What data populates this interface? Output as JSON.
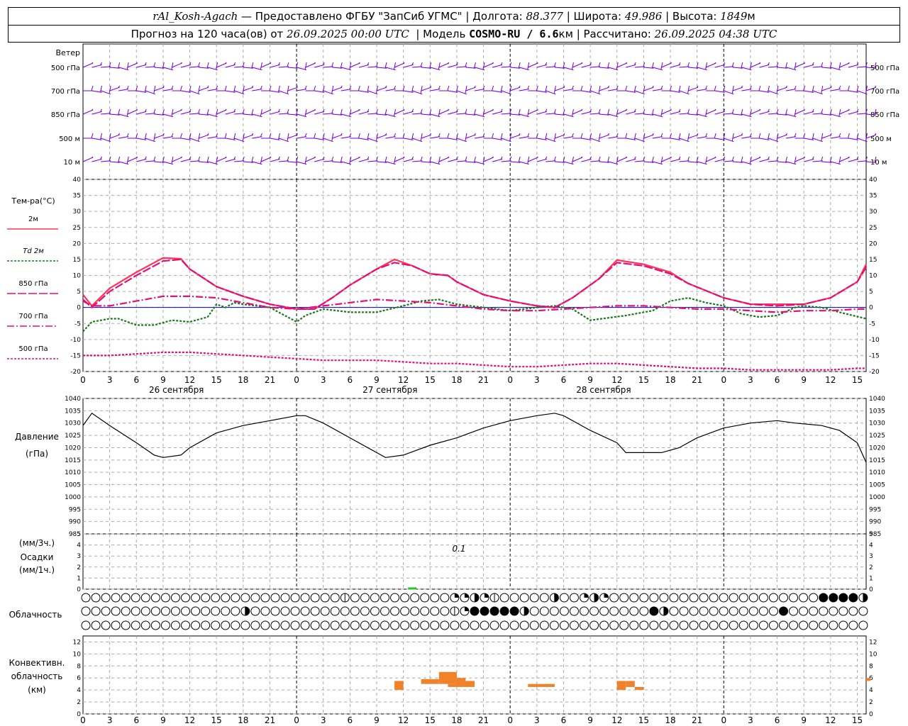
{
  "header": {
    "station": "rAl_Kosh-Agach",
    "provider": " — Предоставлено ФГБУ \"ЗапСиб УГМС\" | Долгота: ",
    "lon": "88.377",
    "lat_label": " | Широта: ",
    "lat": "49.986",
    "alt_label": " | Высота: ",
    "alt": "1849",
    "alt_unit": "м",
    "forecast_label": "Прогноз на 120 часа(ов) от ",
    "run": "26.09.2025 00:00 UTC",
    "model_label": "  | Модель ",
    "model": "COSMO-RU / 6.6",
    "model_unit": "км",
    "calc_label": " | Рассчитано: ",
    "calc": "26.09.2025 04:38 UTC"
  },
  "labels": {
    "wind": "Ветер",
    "wind_levels": [
      "500 гПа",
      "700 гПа",
      "850 гПа",
      "500 м",
      "10 м"
    ],
    "temp": "Тем-ра(°С)",
    "legend": [
      {
        "text": "2м",
        "color": "#ff3355",
        "dash": ""
      },
      {
        "text": "Td 2м",
        "color": "#1a7a1a",
        "dash": "3,2"
      },
      {
        "text": "850 гПа",
        "color": "#e0107a",
        "dash": "12,3"
      },
      {
        "text": "700 гПа",
        "color": "#e0107a",
        "dash": "10,3,2,3"
      },
      {
        "text": "500 гПа",
        "color": "#e0107a",
        "dash": "3,2"
      }
    ],
    "pressure": [
      "Давление",
      "(гПа)"
    ],
    "precip": [
      "(мм/3ч.)",
      "Осадки",
      "(мм/1ч.)"
    ],
    "precip_value": "0.1",
    "cloud": "Облачность",
    "conv": [
      "Конвективн.",
      "облачность",
      "(км)"
    ],
    "dates": [
      "26 сентября",
      "27 сентября",
      "28 сентября"
    ]
  },
  "chart_data": {
    "type": "line",
    "x_hours_from_start": [
      0,
      6,
      12,
      18,
      24,
      30,
      36,
      42,
      48,
      54,
      60,
      66,
      72,
      78
    ],
    "x_tick_labels": [
      "0",
      "3",
      "6",
      "9",
      "12",
      "15",
      "18",
      "21"
    ],
    "temp_axis": {
      "ylim": [
        -20,
        40
      ],
      "ticks": [
        -20,
        -15,
        -10,
        -5,
        0,
        5,
        10,
        15,
        20,
        25,
        30,
        35,
        40
      ]
    },
    "pressure_axis": {
      "ylim": [
        985,
        1040
      ],
      "ticks": [
        985,
        990,
        995,
        1000,
        1005,
        1010,
        1015,
        1020,
        1025,
        1030,
        1035,
        1040
      ]
    },
    "precip_axis": {
      "ylim": [
        0,
        5
      ],
      "ticks": [
        0,
        1,
        2,
        3,
        4,
        5
      ]
    },
    "conv_axis": {
      "ylim": [
        0,
        13
      ],
      "ticks": [
        0,
        2,
        4,
        6,
        8,
        10,
        12
      ]
    },
    "series": [
      {
        "name": "2м",
        "color": "#ff3355",
        "dash": "",
        "points": [
          [
            0,
            4
          ],
          [
            1,
            0.5
          ],
          [
            3,
            6
          ],
          [
            6,
            11
          ],
          [
            9,
            15.5
          ],
          [
            11,
            15.2
          ],
          [
            12,
            12
          ],
          [
            15,
            6.5
          ],
          [
            18,
            3.5
          ],
          [
            21,
            1
          ],
          [
            24,
            -0.5
          ],
          [
            26,
            -0.5
          ],
          [
            28,
            3
          ],
          [
            30,
            7
          ],
          [
            33,
            12
          ],
          [
            35,
            15
          ],
          [
            37,
            13
          ],
          [
            39,
            10.5
          ],
          [
            41,
            10
          ],
          [
            42,
            8
          ],
          [
            45,
            4
          ],
          [
            48,
            2
          ],
          [
            51,
            0.5
          ],
          [
            53,
            0
          ],
          [
            55,
            3
          ],
          [
            58,
            9
          ],
          [
            60,
            14.8
          ],
          [
            63,
            13.5
          ],
          [
            66,
            11
          ],
          [
            68,
            7.5
          ],
          [
            72,
            3
          ],
          [
            75,
            1
          ],
          [
            78,
            1
          ],
          [
            81,
            1
          ],
          [
            84,
            3
          ],
          [
            87,
            8
          ],
          [
            88,
            13.5
          ]
        ]
      },
      {
        "name": "Td 2м",
        "color": "#1a7a1a",
        "dash": "3,2",
        "points": [
          [
            0,
            -7.5
          ],
          [
            1,
            -4.5
          ],
          [
            3,
            -3.5
          ],
          [
            4,
            -3.5
          ],
          [
            6,
            -5.5
          ],
          [
            8,
            -5.5
          ],
          [
            10,
            -4
          ],
          [
            12,
            -4.5
          ],
          [
            14,
            -3
          ],
          [
            15,
            1
          ],
          [
            16,
            0
          ],
          [
            17,
            1.5
          ],
          [
            18,
            1
          ],
          [
            21,
            0
          ],
          [
            24,
            -4.5
          ],
          [
            25,
            -2.5
          ],
          [
            27,
            -0.5
          ],
          [
            30,
            -1.5
          ],
          [
            33,
            -1.5
          ],
          [
            36,
            0.5
          ],
          [
            38,
            2
          ],
          [
            40,
            2.5
          ],
          [
            42,
            1
          ],
          [
            45,
            0
          ],
          [
            48,
            -1
          ],
          [
            51,
            0
          ],
          [
            53,
            0.5
          ],
          [
            55,
            -0.5
          ],
          [
            57,
            -4
          ],
          [
            61,
            -2.5
          ],
          [
            64,
            -1
          ],
          [
            66,
            2
          ],
          [
            68,
            3
          ],
          [
            70,
            1.5
          ],
          [
            72,
            0.5
          ],
          [
            74,
            -2
          ],
          [
            76,
            -3
          ],
          [
            78,
            -2.5
          ],
          [
            80,
            0
          ],
          [
            81,
            0.5
          ],
          [
            83,
            0
          ],
          [
            85,
            -1.5
          ],
          [
            88,
            -3.5
          ]
        ]
      },
      {
        "name": "850 гПа",
        "color": "#e0107a",
        "dash": "12,3",
        "points": [
          [
            0,
            2.5
          ],
          [
            1,
            0
          ],
          [
            3,
            5
          ],
          [
            6,
            10
          ],
          [
            9,
            14.5
          ],
          [
            11,
            15
          ],
          [
            12,
            12
          ],
          [
            15,
            6.5
          ],
          [
            18,
            3.5
          ],
          [
            21,
            1
          ],
          [
            24,
            -0.5
          ],
          [
            26,
            -0.5
          ],
          [
            28,
            3
          ],
          [
            30,
            7
          ],
          [
            33,
            12
          ],
          [
            35,
            14
          ],
          [
            37,
            13
          ],
          [
            39,
            10.5
          ],
          [
            41,
            10
          ],
          [
            42,
            8
          ],
          [
            45,
            4
          ],
          [
            48,
            2
          ],
          [
            51,
            0.5
          ],
          [
            53,
            0
          ],
          [
            55,
            3
          ],
          [
            58,
            9
          ],
          [
            60,
            14
          ],
          [
            63,
            13
          ],
          [
            66,
            10.5
          ],
          [
            68,
            7.5
          ],
          [
            72,
            3
          ],
          [
            75,
            1
          ],
          [
            78,
            0.5
          ],
          [
            81,
            1
          ],
          [
            84,
            3
          ],
          [
            87,
            8
          ],
          [
            88,
            12.5
          ]
        ]
      },
      {
        "name": "700 гПа",
        "color": "#e0107a",
        "dash": "10,3,2,3",
        "points": [
          [
            0,
            2
          ],
          [
            1,
            0.5
          ],
          [
            3,
            0.5
          ],
          [
            6,
            2
          ],
          [
            9,
            3.5
          ],
          [
            12,
            3.5
          ],
          [
            15,
            3
          ],
          [
            18,
            1.5
          ],
          [
            21,
            0
          ],
          [
            24,
            -0.5
          ],
          [
            27,
            0.5
          ],
          [
            30,
            1.5
          ],
          [
            33,
            2.5
          ],
          [
            36,
            2
          ],
          [
            39,
            1.5
          ],
          [
            42,
            0.5
          ],
          [
            45,
            -0.5
          ],
          [
            48,
            -1
          ],
          [
            51,
            -1
          ],
          [
            54,
            -0.5
          ],
          [
            57,
            0
          ],
          [
            60,
            0.5
          ],
          [
            63,
            0.5
          ],
          [
            66,
            0
          ],
          [
            69,
            -0.5
          ],
          [
            72,
            -0.5
          ],
          [
            75,
            -1
          ],
          [
            78,
            -1.5
          ],
          [
            81,
            -1
          ],
          [
            84,
            -1
          ],
          [
            87,
            -0.5
          ],
          [
            88,
            -0.5
          ]
        ]
      },
      {
        "name": "500 гПа",
        "color": "#e0107a",
        "dash": "3,2",
        "points": [
          [
            0,
            -15
          ],
          [
            3,
            -15
          ],
          [
            6,
            -14.5
          ],
          [
            9,
            -14
          ],
          [
            12,
            -14
          ],
          [
            15,
            -14.5
          ],
          [
            18,
            -15
          ],
          [
            21,
            -15.5
          ],
          [
            24,
            -16
          ],
          [
            27,
            -16.5
          ],
          [
            30,
            -16.5
          ],
          [
            33,
            -16.5
          ],
          [
            36,
            -17
          ],
          [
            39,
            -17.5
          ],
          [
            42,
            -17.5
          ],
          [
            45,
            -18
          ],
          [
            48,
            -18.5
          ],
          [
            51,
            -18.5
          ],
          [
            54,
            -18
          ],
          [
            57,
            -17.5
          ],
          [
            60,
            -17.5
          ],
          [
            63,
            -18
          ],
          [
            66,
            -18.5
          ],
          [
            69,
            -19
          ],
          [
            72,
            -19
          ],
          [
            75,
            -19.5
          ],
          [
            78,
            -19.5
          ],
          [
            81,
            -19.5
          ],
          [
            84,
            -19.5
          ],
          [
            87,
            -19
          ],
          [
            88,
            -19
          ]
        ]
      },
      {
        "name": "pressure",
        "color": "#000000",
        "dash": "",
        "points": [
          [
            0,
            1029
          ],
          [
            1,
            1034
          ],
          [
            3,
            1029
          ],
          [
            6,
            1022
          ],
          [
            8,
            1017
          ],
          [
            9,
            1016
          ],
          [
            11,
            1017
          ],
          [
            12,
            1020
          ],
          [
            15,
            1026
          ],
          [
            18,
            1029
          ],
          [
            21,
            1031
          ],
          [
            24,
            1033
          ],
          [
            25,
            1033
          ],
          [
            27,
            1030
          ],
          [
            30,
            1024
          ],
          [
            33,
            1018
          ],
          [
            34,
            1016
          ],
          [
            36,
            1017
          ],
          [
            39,
            1021
          ],
          [
            42,
            1024
          ],
          [
            45,
            1028
          ],
          [
            48,
            1031
          ],
          [
            51,
            1033
          ],
          [
            53,
            1034
          ],
          [
            54,
            1033
          ],
          [
            57,
            1027
          ],
          [
            60,
            1022
          ],
          [
            61,
            1018
          ],
          [
            63,
            1018
          ],
          [
            65,
            1018
          ],
          [
            67,
            1020
          ],
          [
            69,
            1024
          ],
          [
            72,
            1028
          ],
          [
            75,
            1030
          ],
          [
            78,
            1031
          ],
          [
            80,
            1030
          ],
          [
            83,
            1029
          ],
          [
            85,
            1027
          ],
          [
            87,
            1022
          ],
          [
            88,
            1014
          ]
        ]
      }
    ],
    "precip": [
      {
        "hour": 37,
        "value": 0.1
      }
    ],
    "conv_clouds": [
      {
        "from": 35,
        "to": 36,
        "bottom": 4,
        "top": 5.5
      },
      {
        "from": 38,
        "to": 40,
        "bottom": 5,
        "top": 5.8
      },
      {
        "from": 40,
        "to": 42,
        "bottom": 5,
        "top": 7
      },
      {
        "from": 41,
        "to": 42,
        "bottom": 4.5,
        "top": 5
      },
      {
        "from": 42,
        "to": 43,
        "bottom": 4.5,
        "top": 6
      },
      {
        "from": 43,
        "to": 44,
        "bottom": 4.5,
        "top": 5.5
      },
      {
        "from": 50,
        "to": 53,
        "bottom": 4.5,
        "top": 5
      },
      {
        "from": 60,
        "to": 61,
        "bottom": 4,
        "top": 5.5
      },
      {
        "from": 61,
        "to": 62,
        "bottom": 4.5,
        "top": 5.5
      },
      {
        "from": 62,
        "to": 63,
        "bottom": 4,
        "top": 4.5
      },
      {
        "from": 88,
        "to": 88.5,
        "bottom": 5.5,
        "top": 6
      }
    ],
    "cloud_rows": [
      "0000000000000000000000000010000000000224210000040024200000000000000000000088883414344412021444",
      "0000000000000000300000000000000000000128888830000000000008300000000000800000000000000000301488888148",
      "000000000000000000000000000000000000000000000000000000000000000000000000000000000000000000000000"
    ],
    "wind_colors": {
      "barb": "#7700cc",
      "line": "#3355ff"
    }
  },
  "colors": {
    "grid": "#aaaaaa",
    "zero_line": "#0000cc",
    "conv": "#f0822a",
    "precip": "#22cc22"
  }
}
